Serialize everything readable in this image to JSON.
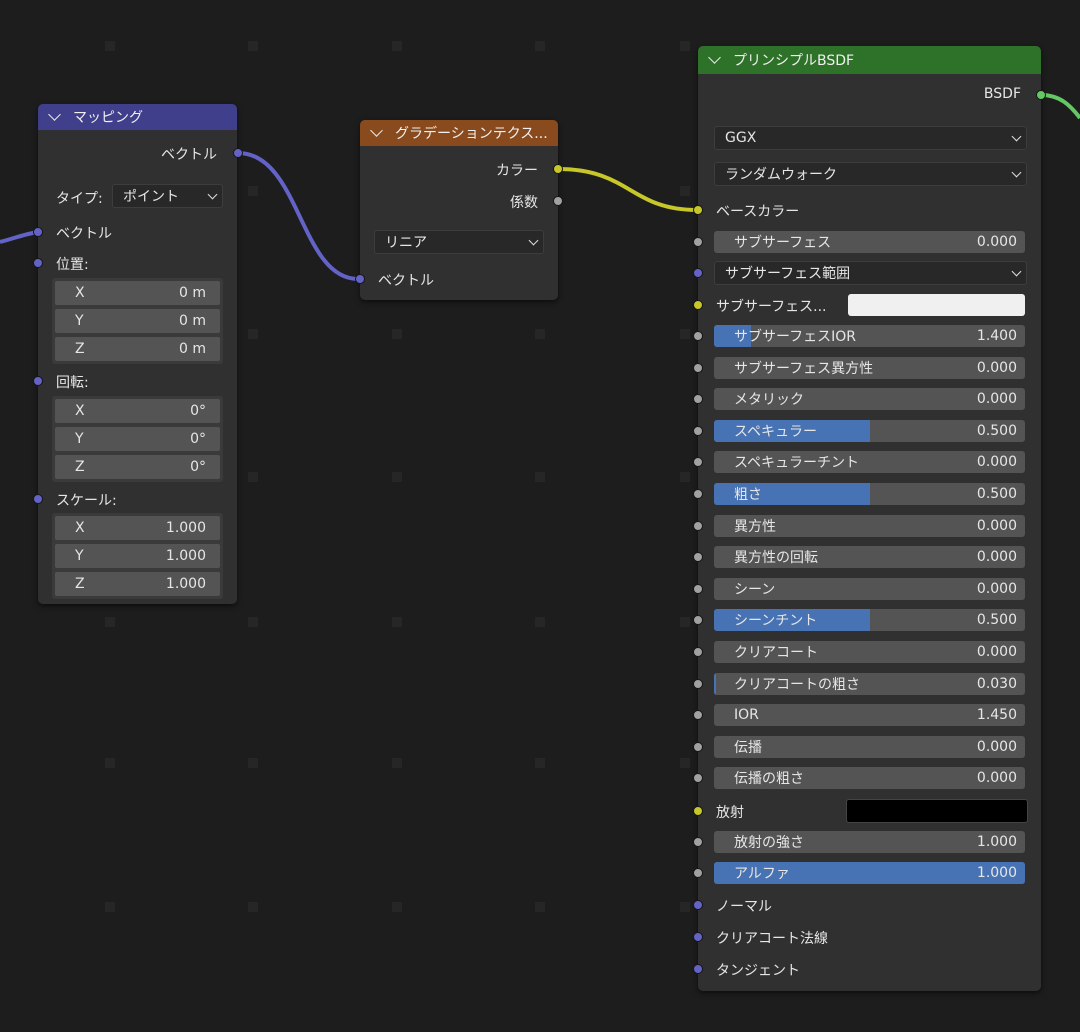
{
  "mapping": {
    "title": "マッピング",
    "output_vector": "ベクトル",
    "type_label": "タイプ:",
    "type_value": "ポイント",
    "input_vector": "ベクトル",
    "location_label": "位置:",
    "location": [
      {
        "axis": "X",
        "value": "0 m"
      },
      {
        "axis": "Y",
        "value": "0 m"
      },
      {
        "axis": "Z",
        "value": "0 m"
      }
    ],
    "rotation_label": "回転:",
    "rotation": [
      {
        "axis": "X",
        "value": "0°"
      },
      {
        "axis": "Y",
        "value": "0°"
      },
      {
        "axis": "Z",
        "value": "0°"
      }
    ],
    "scale_label": "スケール:",
    "scale": [
      {
        "axis": "X",
        "value": "1.000"
      },
      {
        "axis": "Y",
        "value": "1.000"
      },
      {
        "axis": "Z",
        "value": "1.000"
      }
    ]
  },
  "gradient": {
    "title": "グラデーションテクス...",
    "output_color": "カラー",
    "output_fac": "係数",
    "type_value": "リニア",
    "input_vector": "ベクトル"
  },
  "bsdf": {
    "title": "プリンシプルBSDF",
    "output_bsdf": "BSDF",
    "distribution": "GGX",
    "subsurface_method": "ランダムウォーク",
    "base_color_label": "ベースカラー",
    "subsurface": {
      "label": "サブサーフェス",
      "value": "0.000",
      "fill": 0
    },
    "subsurface_radius": "サブサーフェス範囲",
    "subsurface_color_label": "サブサーフェス...",
    "fields_a": [
      {
        "label": "サブサーフェスIOR",
        "value": "1.400",
        "fill": 0.12
      },
      {
        "label": "サブサーフェス異方性",
        "value": "0.000",
        "fill": 0
      },
      {
        "label": "メタリック",
        "value": "0.000",
        "fill": 0
      },
      {
        "label": "スペキュラー",
        "value": "0.500",
        "fill": 0.5
      },
      {
        "label": "スペキュラーチント",
        "value": "0.000",
        "fill": 0
      },
      {
        "label": "粗さ",
        "value": "0.500",
        "fill": 0.5
      },
      {
        "label": "異方性",
        "value": "0.000",
        "fill": 0
      },
      {
        "label": "異方性の回転",
        "value": "0.000",
        "fill": 0
      },
      {
        "label": "シーン",
        "value": "0.000",
        "fill": 0
      },
      {
        "label": "シーンチント",
        "value": "0.500",
        "fill": 0.5
      },
      {
        "label": "クリアコート",
        "value": "0.000",
        "fill": 0
      },
      {
        "label": "クリアコートの粗さ",
        "value": "0.030",
        "fill": 0.03
      },
      {
        "label": "IOR",
        "value": "1.450",
        "fill": 0
      },
      {
        "label": "伝播",
        "value": "0.000",
        "fill": 0
      },
      {
        "label": "伝播の粗さ",
        "value": "0.000",
        "fill": 0
      }
    ],
    "emission_label": "放射",
    "fields_b": [
      {
        "label": "放射の強さ",
        "value": "1.000",
        "fill": 0
      },
      {
        "label": "アルファ",
        "value": "1.000",
        "fill": 1
      }
    ],
    "normal_label": "ノーマル",
    "clearcoat_normal_label": "クリアコート法線",
    "tangent_label": "タンジェント"
  },
  "colors": {
    "mapping_header": "#3f3f8c",
    "gradient_header": "#894b1e",
    "bsdf_header": "#2e7128",
    "field_fill": "#4772b3",
    "subsurface_color": "#f0f0f0",
    "emission_color": "#000000"
  }
}
